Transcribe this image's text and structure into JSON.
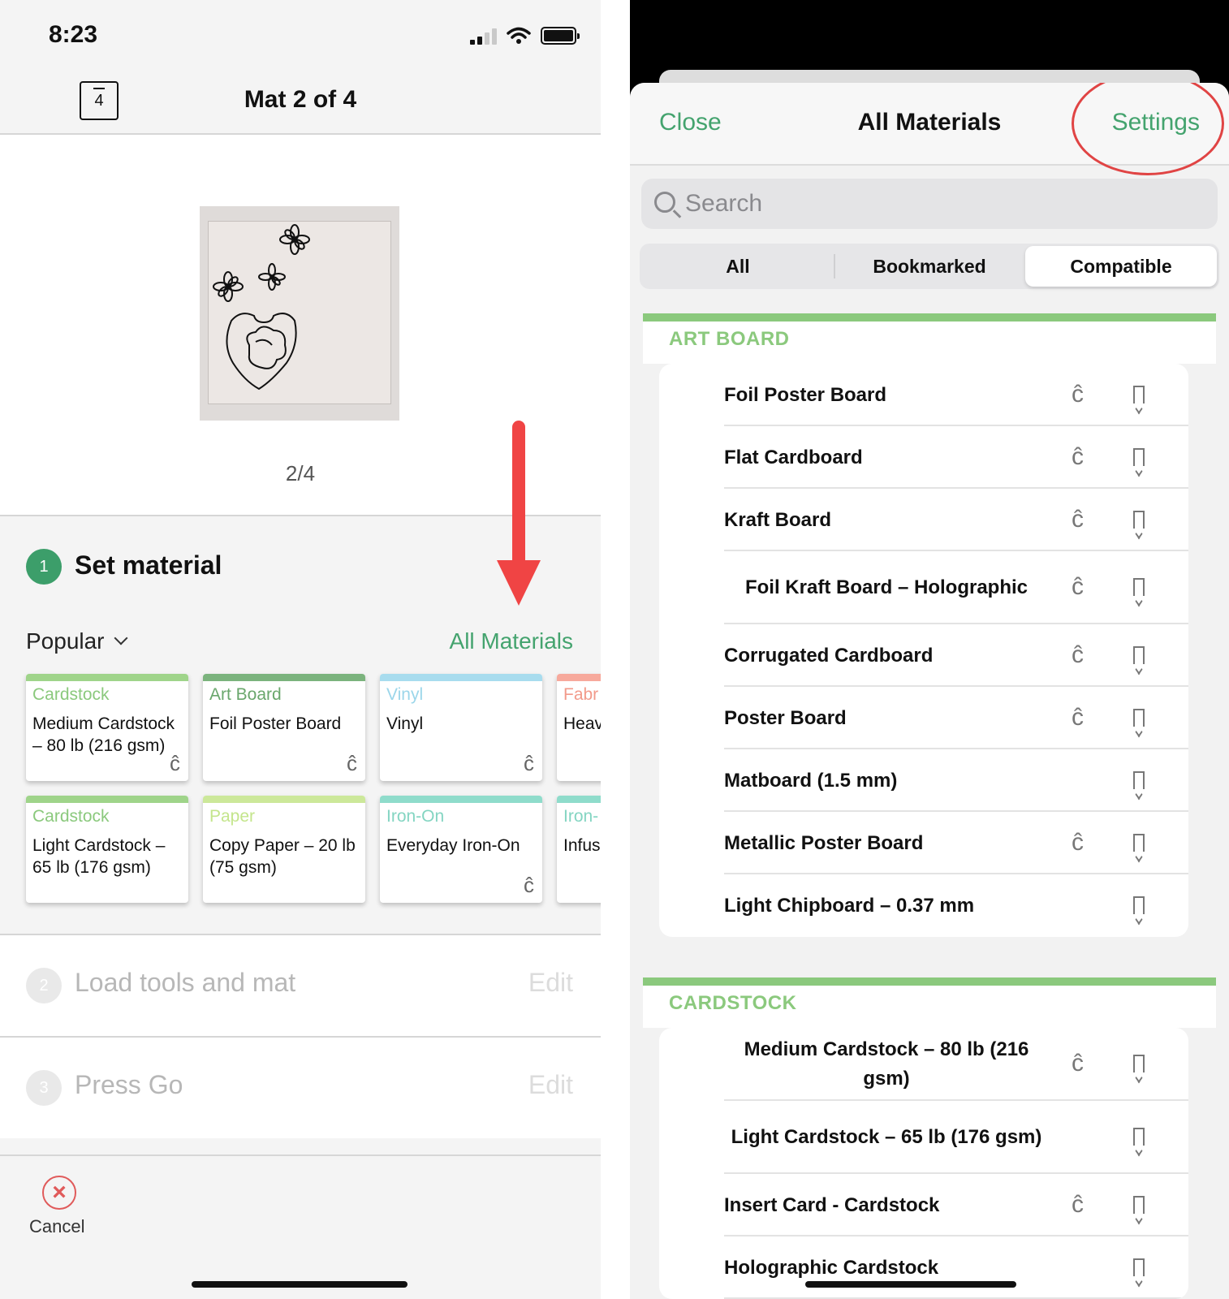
{
  "left": {
    "status": {
      "time": "8:23"
    },
    "header": {
      "mat_count": "4",
      "title": "Mat 2 of 4"
    },
    "preview": {
      "page_label": "2/4"
    },
    "set_material": {
      "step_number": "1",
      "title": "Set material",
      "filter_label": "Popular",
      "all_materials_link": "All Materials",
      "cards": [
        {
          "category": "Cardstock",
          "name": "Medium Cardstock – 80 lb (216 gsm)",
          "color": "#9fd48a",
          "cat_color": "#8bc97d",
          "cut": true
        },
        {
          "category": "Art Board",
          "name": "Foil Poster Board",
          "color": "#7bb37d",
          "cat_color": "#6aa76c",
          "cut": true
        },
        {
          "category": "Vinyl",
          "name": "Vinyl",
          "color": "#a8dcee",
          "cat_color": "#9bd6ea",
          "cut": true
        },
        {
          "category": "Fabr",
          "name": "Heav (like",
          "color": "#f7a99c",
          "cat_color": "#f29a8a",
          "cut": false
        },
        {
          "category": "Cardstock",
          "name": "Light Cardstock – 65 lb (176 gsm)",
          "color": "#9fd48a",
          "cat_color": "#8bc97d",
          "cut": false
        },
        {
          "category": "Paper",
          "name": "Copy Paper – 20 lb (75 gsm)",
          "color": "#cce89a",
          "cat_color": "#c4e58c",
          "cut": false
        },
        {
          "category": "Iron-On",
          "name": "Everyday Iron-On",
          "color": "#8fdccb",
          "cat_color": "#84d5c2",
          "cut": true
        },
        {
          "category": "Iron-",
          "name": "Infus Tran",
          "color": "#8fdccb",
          "cat_color": "#84d5c2",
          "cut": false
        }
      ]
    },
    "steps": [
      {
        "number": "2",
        "label": "Load tools and mat",
        "edit": "Edit"
      },
      {
        "number": "3",
        "label": "Press Go",
        "edit": "Edit"
      }
    ],
    "cancel_label": "Cancel",
    "colors": {
      "accent": "#44a36e",
      "arrow": "#f04444"
    }
  },
  "right": {
    "header": {
      "close": "Close",
      "title": "All Materials",
      "settings": "Settings"
    },
    "search": {
      "placeholder": "Search"
    },
    "tabs": [
      {
        "label": "All",
        "selected": false
      },
      {
        "label": "Bookmarked",
        "selected": false
      },
      {
        "label": "Compatible",
        "selected": true
      }
    ],
    "sections": [
      {
        "title": "ART BOARD",
        "items": [
          {
            "name": "Foil Poster Board",
            "cut_icon": true
          },
          {
            "name": "Flat Cardboard",
            "cut_icon": true
          },
          {
            "name": "Kraft Board",
            "cut_icon": true
          },
          {
            "name": "Foil Kraft Board  – Holographic",
            "cut_icon": true
          },
          {
            "name": "Corrugated Cardboard",
            "cut_icon": true
          },
          {
            "name": "Poster Board",
            "cut_icon": true
          },
          {
            "name": "Matboard (1.5 mm)",
            "cut_icon": false
          },
          {
            "name": "Metallic Poster Board",
            "cut_icon": true
          },
          {
            "name": "Light Chipboard – 0.37 mm",
            "cut_icon": false
          }
        ]
      },
      {
        "title": "CARDSTOCK",
        "items": [
          {
            "name": "Medium Cardstock – 80 lb (216 gsm)",
            "cut_icon": true
          },
          {
            "name": "Light Cardstock – 65 lb (176 gsm)",
            "cut_icon": false
          },
          {
            "name": "Insert Card - Cardstock",
            "cut_icon": true
          },
          {
            "name": "Holographic Cardstock",
            "cut_icon": false
          }
        ]
      }
    ],
    "colors": {
      "accent": "#44a36e",
      "section": "#8bc97d",
      "highlight_ring": "#e04444"
    }
  },
  "icons": {
    "cut": "cricut-c-icon",
    "bookmark": "bookmark-icon",
    "cancel": "cancel-x-icon",
    "search": "search-icon"
  }
}
